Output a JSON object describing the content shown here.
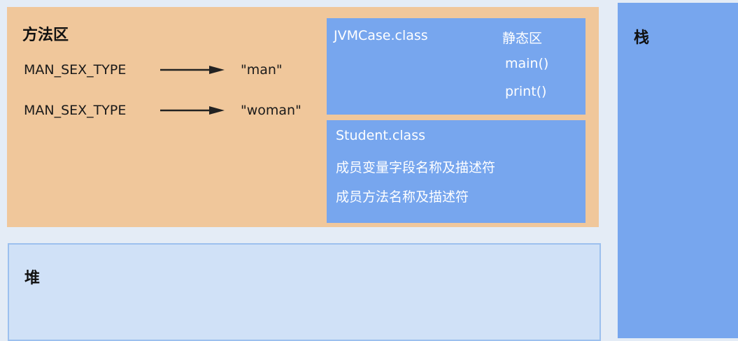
{
  "method_area": {
    "title": "方法区",
    "constants": [
      {
        "name": "MAN_SEX_TYPE",
        "value": "\"man\""
      },
      {
        "name": "MAN_SEX_TYPE",
        "value": "\"woman\""
      }
    ],
    "jvmcase_class": {
      "name": "JVMCase.class",
      "static_label": "静态区",
      "methods": [
        "main()",
        "print()"
      ]
    },
    "student_class": {
      "name": "Student.class",
      "lines": [
        "成员变量字段名称及描述符",
        "成员方法名称及描述符"
      ]
    }
  },
  "heap": {
    "title": "堆"
  },
  "stack": {
    "title": "栈"
  },
  "colors": {
    "method_area_bg": "#f0c79b",
    "class_box_bg": "#77a6ee",
    "heap_bg": "#d0e1f7",
    "stack_bg": "#77a6ee",
    "page_bg": "#e4ecf6"
  }
}
